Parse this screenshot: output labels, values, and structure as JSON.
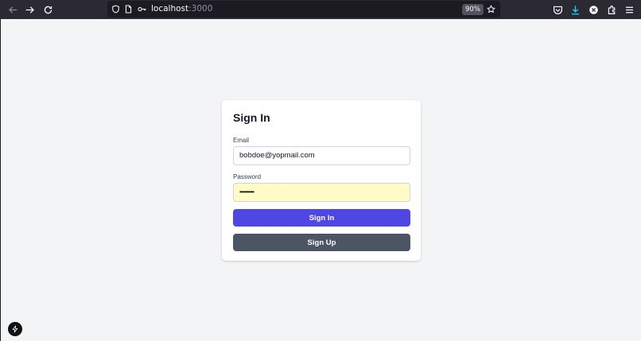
{
  "browser": {
    "url_host": "localhost",
    "url_port": ":3000",
    "zoom": "90%",
    "icons": [
      "back-icon",
      "forward-icon",
      "reload-icon",
      "shield-icon",
      "page-icon",
      "key-icon",
      "star-icon",
      "pocket-icon",
      "download-icon",
      "extension-icon",
      "puzzle-icon",
      "menu-icon"
    ]
  },
  "form": {
    "title": "Sign In",
    "email_label": "Email",
    "email_value": "bobdoe@yopmail.com",
    "password_label": "Password",
    "password_value": "••••••••••",
    "sign_in_label": "Sign In",
    "sign_up_label": "Sign Up"
  },
  "colors": {
    "primary": "#4f46e5",
    "secondary": "#4b5563",
    "autofill": "#fefbc7",
    "page_bg": "#f3f4f6"
  }
}
